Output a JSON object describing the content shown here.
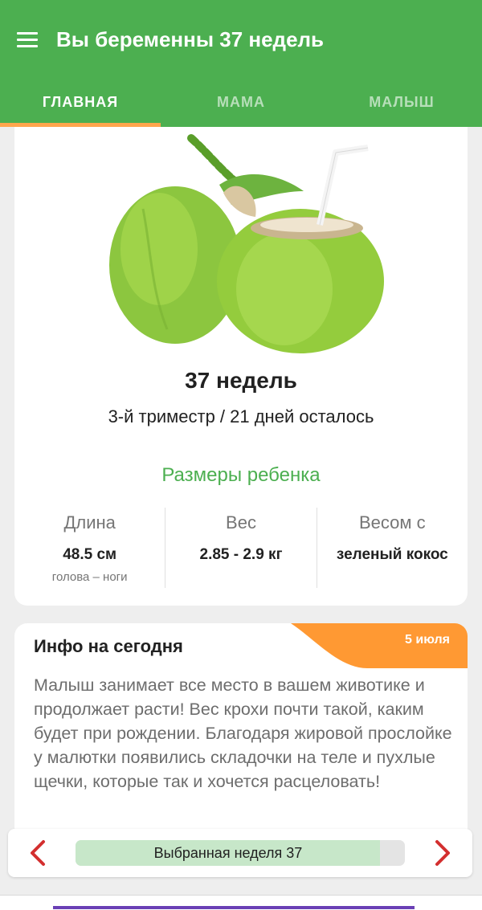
{
  "appbar": {
    "title": "Вы беременны 37 недель",
    "menu_icon": "hamburger-menu-icon",
    "background_color": "#4caf50",
    "tab_indicator_color": "#ffa64d"
  },
  "tabs": [
    {
      "label": "ГЛАВНАЯ",
      "active": true
    },
    {
      "label": "МАМА",
      "active": false
    },
    {
      "label": "МАЛЫШ",
      "active": false
    }
  ],
  "week_card": {
    "image": "green-coconut-illustration",
    "week_title": "37 недель",
    "subtitle": "3-й триместр / 21 дней осталось",
    "sizes_title": "Размеры ребенка",
    "stats": [
      {
        "label": "Длина",
        "value": "48.5 см",
        "note": "голова – ноги"
      },
      {
        "label": "Вес",
        "value": "2.85 - 2.9 кг",
        "note": ""
      },
      {
        "label": "Весом с",
        "value": "зеленый кокос",
        "note": ""
      }
    ]
  },
  "info_card": {
    "heading": "Инфо на сегодня",
    "date": "5 июля",
    "badge_color": "#ff9933",
    "text": "Малыш занимает все место в вашем животике и продолжает расти! Вес крохи почти такой, каким будет при рождении. Благодаря жировой прослойке у малютки появились складочки на теле и пухлые щечки, которые так и хочется расцеловать!"
  },
  "week_selector": {
    "label": "Выбранная неделя 37",
    "progress": 0.925,
    "prev_icon": "chevron-left-icon",
    "next_icon": "chevron-right-icon",
    "arrow_color": "#d32f2f"
  }
}
